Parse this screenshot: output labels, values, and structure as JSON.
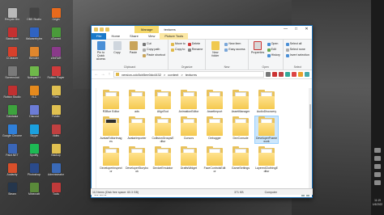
{
  "desktop": {
    "icons": [
      {
        "label": "Recycle Bin",
        "color": "#b9b9b9"
      },
      {
        "label": "Bandicam",
        "color": "#c43030"
      },
      {
        "label": "CCleaner",
        "color": "#d8402b"
      },
      {
        "label": "Screenshot",
        "color": "#7a7a7a"
      },
      {
        "label": "Roblox Studio",
        "color": "#c03030"
      },
      {
        "label": "Camtasia",
        "color": "#3da33d"
      },
      {
        "label": "Google Chrome",
        "color": "#2f7fd9"
      },
      {
        "label": "Paint.NET",
        "color": "#3a66b8"
      },
      {
        "label": "Audacity",
        "color": "#d94f2a"
      },
      {
        "label": "Steam",
        "color": "#25364c"
      },
      {
        "label": "OBS Studio",
        "color": "#444"
      },
      {
        "label": "Malwarebytes",
        "color": "#2f63c2"
      },
      {
        "label": "Blender",
        "color": "#e0872d"
      },
      {
        "label": "Notepad++",
        "color": "#6fb84a"
      },
      {
        "label": "VLC",
        "color": "#e68a1d"
      },
      {
        "label": "Discord",
        "color": "#6c7cd6"
      },
      {
        "label": "Skype",
        "color": "#1ba0de"
      },
      {
        "label": "Spotify",
        "color": "#1db954"
      },
      {
        "label": "Photoshop",
        "color": "#2a4a8a"
      },
      {
        "label": "Minecraft",
        "color": "#5a8a3a"
      },
      {
        "label": "Origin",
        "color": "#e86a1d"
      },
      {
        "label": "uTorrent",
        "color": "#4a9a3a"
      },
      {
        "label": "WinRAR",
        "color": "#8a3a8a"
      },
      {
        "label": "Roblox Player",
        "color": "#d03b3b"
      },
      {
        "label": "Files",
        "color": "#e0c050"
      },
      {
        "label": "Folder",
        "color": "#e0c050"
      },
      {
        "label": "Video",
        "color": "#c04040"
      },
      {
        "label": "Backup",
        "color": "#e0c050"
      },
      {
        "label": "Administrator",
        "color": "#3a6ab8"
      },
      {
        "label": "Tools",
        "color": "#c03a3a"
      }
    ]
  },
  "window": {
    "title": "textures",
    "context_tab": "Manage",
    "controls": {
      "minimize": "—",
      "maximize": "□",
      "close": "✕"
    },
    "tabs": [
      {
        "label": "File"
      },
      {
        "label": "Home"
      },
      {
        "label": "Share"
      },
      {
        "label": "View"
      },
      {
        "label": "Picture Tools"
      }
    ],
    "ribbon": {
      "clipboard": {
        "label": "Clipboard",
        "pin": "Pin to Quick access",
        "copy": "Copy",
        "paste": "Paste",
        "cut": "Cut",
        "copy_path": "Copy path",
        "paste_shortcut": "Paste shortcut"
      },
      "organize": {
        "label": "Organize",
        "move_to": "Move to",
        "copy_to": "Copy to",
        "delete": "Delete",
        "rename": "Rename"
      },
      "new": {
        "label": "New",
        "new_folder": "New folder",
        "new_item": "New item",
        "easy_access": "Easy access"
      },
      "open": {
        "label": "Open",
        "properties": "Properties",
        "open": "Open",
        "edit": "Edit",
        "history": "History"
      },
      "select": {
        "label": "Select",
        "select_all": "Select all",
        "select_none": "Select none",
        "invert": "Invert selection"
      }
    },
    "address": {
      "path": [
        "version-cdc5cb5ee0dc4432",
        "content",
        "textures"
      ],
      "separator": ">"
    },
    "items_row1": [
      "R3Bce Editor",
      "ads",
      "AlignTool",
      "AnimationEditor",
      "AssetImport",
      "AssetManager",
      "AudioDiscovery"
    ],
    "items_row2": [
      "AvatarEditorImages",
      "AvatarImporter",
      "CollisionGroupsEditor",
      "Cursors",
      "Debugger",
      "DevConsole",
      "DeveloperFramework"
    ],
    "items_row3": [
      "DeveloperInspector",
      "DeveloperStorybook",
      "DeviceEmulator",
      "DraftsWidget",
      "FaceControlsEditor",
      "GameSettings",
      "LayeredClothingEditor"
    ],
    "status": "112 items",
    "details": {
      "disk": "112 items (Disk free space: 60.3 GB)",
      "size": "371 KB",
      "location": "Computer"
    }
  },
  "taskbar_right": {
    "time": "11:19",
    "date": "1/6/2022"
  }
}
